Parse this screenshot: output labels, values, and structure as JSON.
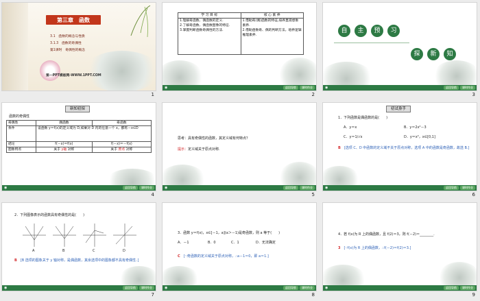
{
  "slides": [
    {
      "number": "1",
      "title": "第三章　函数",
      "sections": [
        "3.1　函数的概念与性质",
        "3.1.3　函数的奇偶性",
        "第1课时　奇偶性的概念"
      ],
      "watermark": "第一PPT模板网-WWW.1PPT.COM"
    },
    {
      "number": "2",
      "headers": [
        "学 习 目 标",
        "核 心 素 养"
      ],
      "goals": [
        "1.理解奇函数、偶函数的定义.",
        "2.了解奇函数、偶函数图像的特征.",
        "3.掌握判断函数奇偶性的方法."
      ],
      "literacy": [
        "1.借助奇(偶)函数的特征,培养直观想象素养.",
        "2.借助函数奇、偶的判断方法，培养逻辑推理素养."
      ]
    },
    {
      "number": "3",
      "row1": [
        "自",
        "主",
        "预",
        "习"
      ],
      "row2": [
        "探",
        "新",
        "知"
      ]
    },
    {
      "number": "4",
      "banner": "新知初探",
      "heading": "函数的奇偶性",
      "headers": [
        "奇偶性",
        "偶函数",
        "奇函数"
      ],
      "cond_label": "条件",
      "cond_text": "设函数 y＝f(x)的定义域为 D,如果对 D 内的任意一个 x，都有－x∈D",
      "concl_label": "结论",
      "even_concl": "f(－x)＝f(x)",
      "odd_concl": "f(－x)＝－f(x)",
      "feat_label": "图象特点",
      "even_feat": [
        "关于",
        "y轴",
        "对称"
      ],
      "odd_feat": [
        "关于",
        "原点",
        "对称"
      ]
    },
    {
      "number": "5",
      "question": "思考：具有奇偶性的函数，其定义域有何特点？",
      "hint_label": "提示：",
      "hint_text": "定义域关于原点对称."
    },
    {
      "number": "6",
      "banner": "初试身手",
      "question": "1．下列函数是偶函数的是(　　)",
      "options": [
        "A．y＝x",
        "B．y＝2x²－3",
        "C．y＝1/√x",
        "D．y＝x²，x∈[0,1]"
      ],
      "answer": "B",
      "explain": "[选项 C、D 中函数的定义域不关于原点对称，选项 A 中的函数是奇函数，故选 B.]"
    },
    {
      "number": "7",
      "question": "2．下列图像表示的函数具有奇偶性的是(　　)",
      "graph_labels": [
        "A",
        "B",
        "C",
        "D"
      ],
      "answer": "B",
      "explain": "[B 选项的图象关于 y 轴对称，是偶函数，其余选项中的图象都不具有奇偶性．]"
    },
    {
      "number": "8",
      "question": "3．函数 y＝f(x)，x∈[－1，a](a＞－1)是奇函数，则 a 等于(　　)",
      "options": [
        "A．－1",
        "B．0",
        "C．1",
        "D．无法确定"
      ],
      "answer": "C",
      "explain": "[∵奇函数的定义域关于原点对称，∴a－1＝0，即 a＝1.]"
    },
    {
      "number": "9",
      "question": "4．若 f(x)为 R 上的偶函数，且 f(2)＝3，则 f(－2)＝________.",
      "answer": "3",
      "explain": "[∵f(x)为 R 上的偶函数，∴f(－2)＝f(2)＝3.]"
    }
  ],
  "footer": {
    "left_icon": "ppt-icon",
    "btn1": "返回导航",
    "btn2": "课时作业"
  },
  "colors": {
    "accent": "#2d7a44",
    "title_red": "#c2361b",
    "answer_red": "#d3272a"
  }
}
